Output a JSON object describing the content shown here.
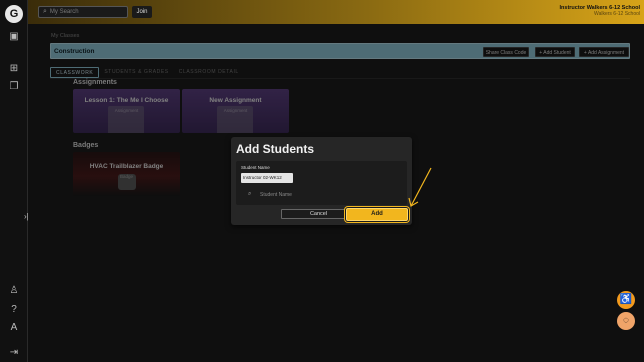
{
  "topbar": {
    "search_placeholder": "My Search",
    "join_label": "Join",
    "user_name": "Instructor Walkers 6-12 School",
    "school_name": "Walkers 6-12 School"
  },
  "sidebar": {
    "icons": [
      "home-icon",
      "grid-icon",
      "copy-icon",
      "user-icon",
      "help-icon",
      "translate-icon",
      "logout-icon"
    ]
  },
  "breadcrumb": "My Classes",
  "class_bar": {
    "title": "Construction",
    "share_code_label": "Share Class Code",
    "add_student_label": "+ Add Student",
    "add_assignment_label": "+ Add Assignment"
  },
  "tabs": [
    {
      "label": "CLASSWORK",
      "active": true
    },
    {
      "label": "STUDENTS & GRADES",
      "active": false
    },
    {
      "label": "CLASSROOM DETAIL",
      "active": false
    }
  ],
  "assignments": {
    "heading": "Assignments",
    "items": [
      {
        "title": "Lesson 1: The Me I Choose",
        "ghost": "Assignment"
      },
      {
        "title": "New Assignment",
        "ghost": "Assignment"
      }
    ]
  },
  "badges": {
    "heading": "Badges",
    "items": [
      {
        "title": "HVAC Trailblazer Badge",
        "ghost": "Badge"
      }
    ]
  },
  "modal": {
    "title": "Add Students",
    "field_label": "Student Name",
    "selected_student": "Instructor 02-WK12",
    "search_placeholder": "Student Name",
    "cancel_label": "Cancel",
    "add_label": "Add"
  },
  "colors": {
    "accent": "#f2b61e",
    "class_bar": "#8ec5d6",
    "assignment_card": "#4a3468"
  }
}
